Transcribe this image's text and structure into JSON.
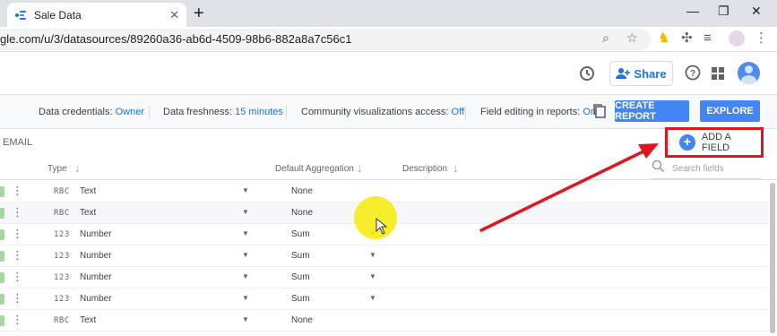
{
  "browser": {
    "tab_title": "Sale Data",
    "tab_close": "✕",
    "new_tab": "+",
    "controls": [
      "—",
      "❐",
      "✕"
    ],
    "url": "gle.com/u/3/datasources/89260a36-ab6d-4509-98b6-882a8a7c56c1"
  },
  "header": {
    "share_label": "Share"
  },
  "infobar": {
    "credentials_label": "Data credentials:",
    "credentials_value": "Owner",
    "freshness_label": "Data freshness:",
    "freshness_value": "15 minutes",
    "community_label": "Community visualizations access:",
    "community_value": "Off",
    "field_editing_label": "Field editing in reports:",
    "field_editing_value": "On",
    "create_report": "CREATE REPORT",
    "explore": "EXPLORE"
  },
  "section": {
    "email_label": "EMAIL",
    "add_field": "ADD A FIELD"
  },
  "columns": {
    "type": "Type",
    "default_aggregation": "Default Aggregation",
    "description": "Description",
    "search_placeholder": "Search fields"
  },
  "rows": [
    {
      "code": "RBC",
      "type": "Text",
      "aggregation": "None"
    },
    {
      "code": "RBC",
      "type": "Text",
      "aggregation": "None"
    },
    {
      "code": "123",
      "type": "Number",
      "aggregation": "Sum"
    },
    {
      "code": "123",
      "type": "Number",
      "aggregation": "Sum"
    },
    {
      "code": "123",
      "type": "Number",
      "aggregation": "Sum"
    },
    {
      "code": "123",
      "type": "Number",
      "aggregation": "Sum"
    },
    {
      "code": "RBC",
      "type": "Text",
      "aggregation": "None"
    }
  ],
  "colors": {
    "accent": "#4285f4",
    "link": "#1a73e8",
    "annotation": "#e0161c",
    "cursor_highlight": "#f6eb14"
  }
}
